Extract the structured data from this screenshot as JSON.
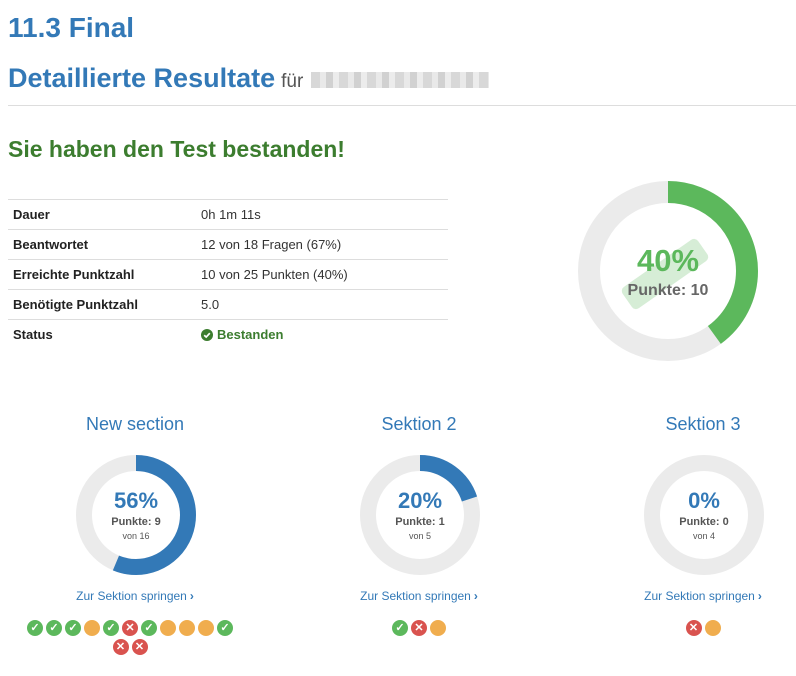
{
  "header": {
    "title": "11.3 Final",
    "subtitle": "Detaillierte Resultate",
    "for_label": "für"
  },
  "result_message": "Sie haben den Test bestanden!",
  "summary": [
    {
      "label": "Dauer",
      "value": "0h 1m 11s"
    },
    {
      "label": "Beantwortet",
      "value": "12 von 18 Fragen (67%)"
    },
    {
      "label": "Erreichte Punktzahl",
      "value": "10 von 25 Punkten (40%)"
    },
    {
      "label": "Benötigte Punktzahl",
      "value": "5.0"
    },
    {
      "label": "Status",
      "value": "Bestanden"
    }
  ],
  "overall": {
    "percent": "40%",
    "points": "Punkte: 10",
    "fraction": 0.4
  },
  "sections": [
    {
      "title": "New section",
      "percent": "56%",
      "points": "Punkte: 9",
      "of": "von 16",
      "fraction": 0.5625,
      "link": "Zur Sektion springen",
      "questions": [
        "correct",
        "correct",
        "correct",
        "open",
        "correct",
        "wrong",
        "correct",
        "open",
        "open",
        "open",
        "correct",
        "wrong",
        "wrong"
      ]
    },
    {
      "title": "Sektion 2",
      "percent": "20%",
      "points": "Punkte: 1",
      "of": "von 5",
      "fraction": 0.2,
      "link": "Zur Sektion springen",
      "questions": [
        "correct",
        "wrong",
        "open"
      ]
    },
    {
      "title": "Sektion 3",
      "percent": "0%",
      "points": "Punkte: 0",
      "of": "von 4",
      "fraction": 0,
      "link": "Zur Sektion springen",
      "questions": [
        "wrong",
        "open"
      ]
    }
  ],
  "colors": {
    "primary": "#3379b7",
    "success": "#5cb85c",
    "success_dark": "#3c7d2f",
    "danger": "#d9534f",
    "warning": "#f0ad4e",
    "track": "#ebebeb"
  }
}
